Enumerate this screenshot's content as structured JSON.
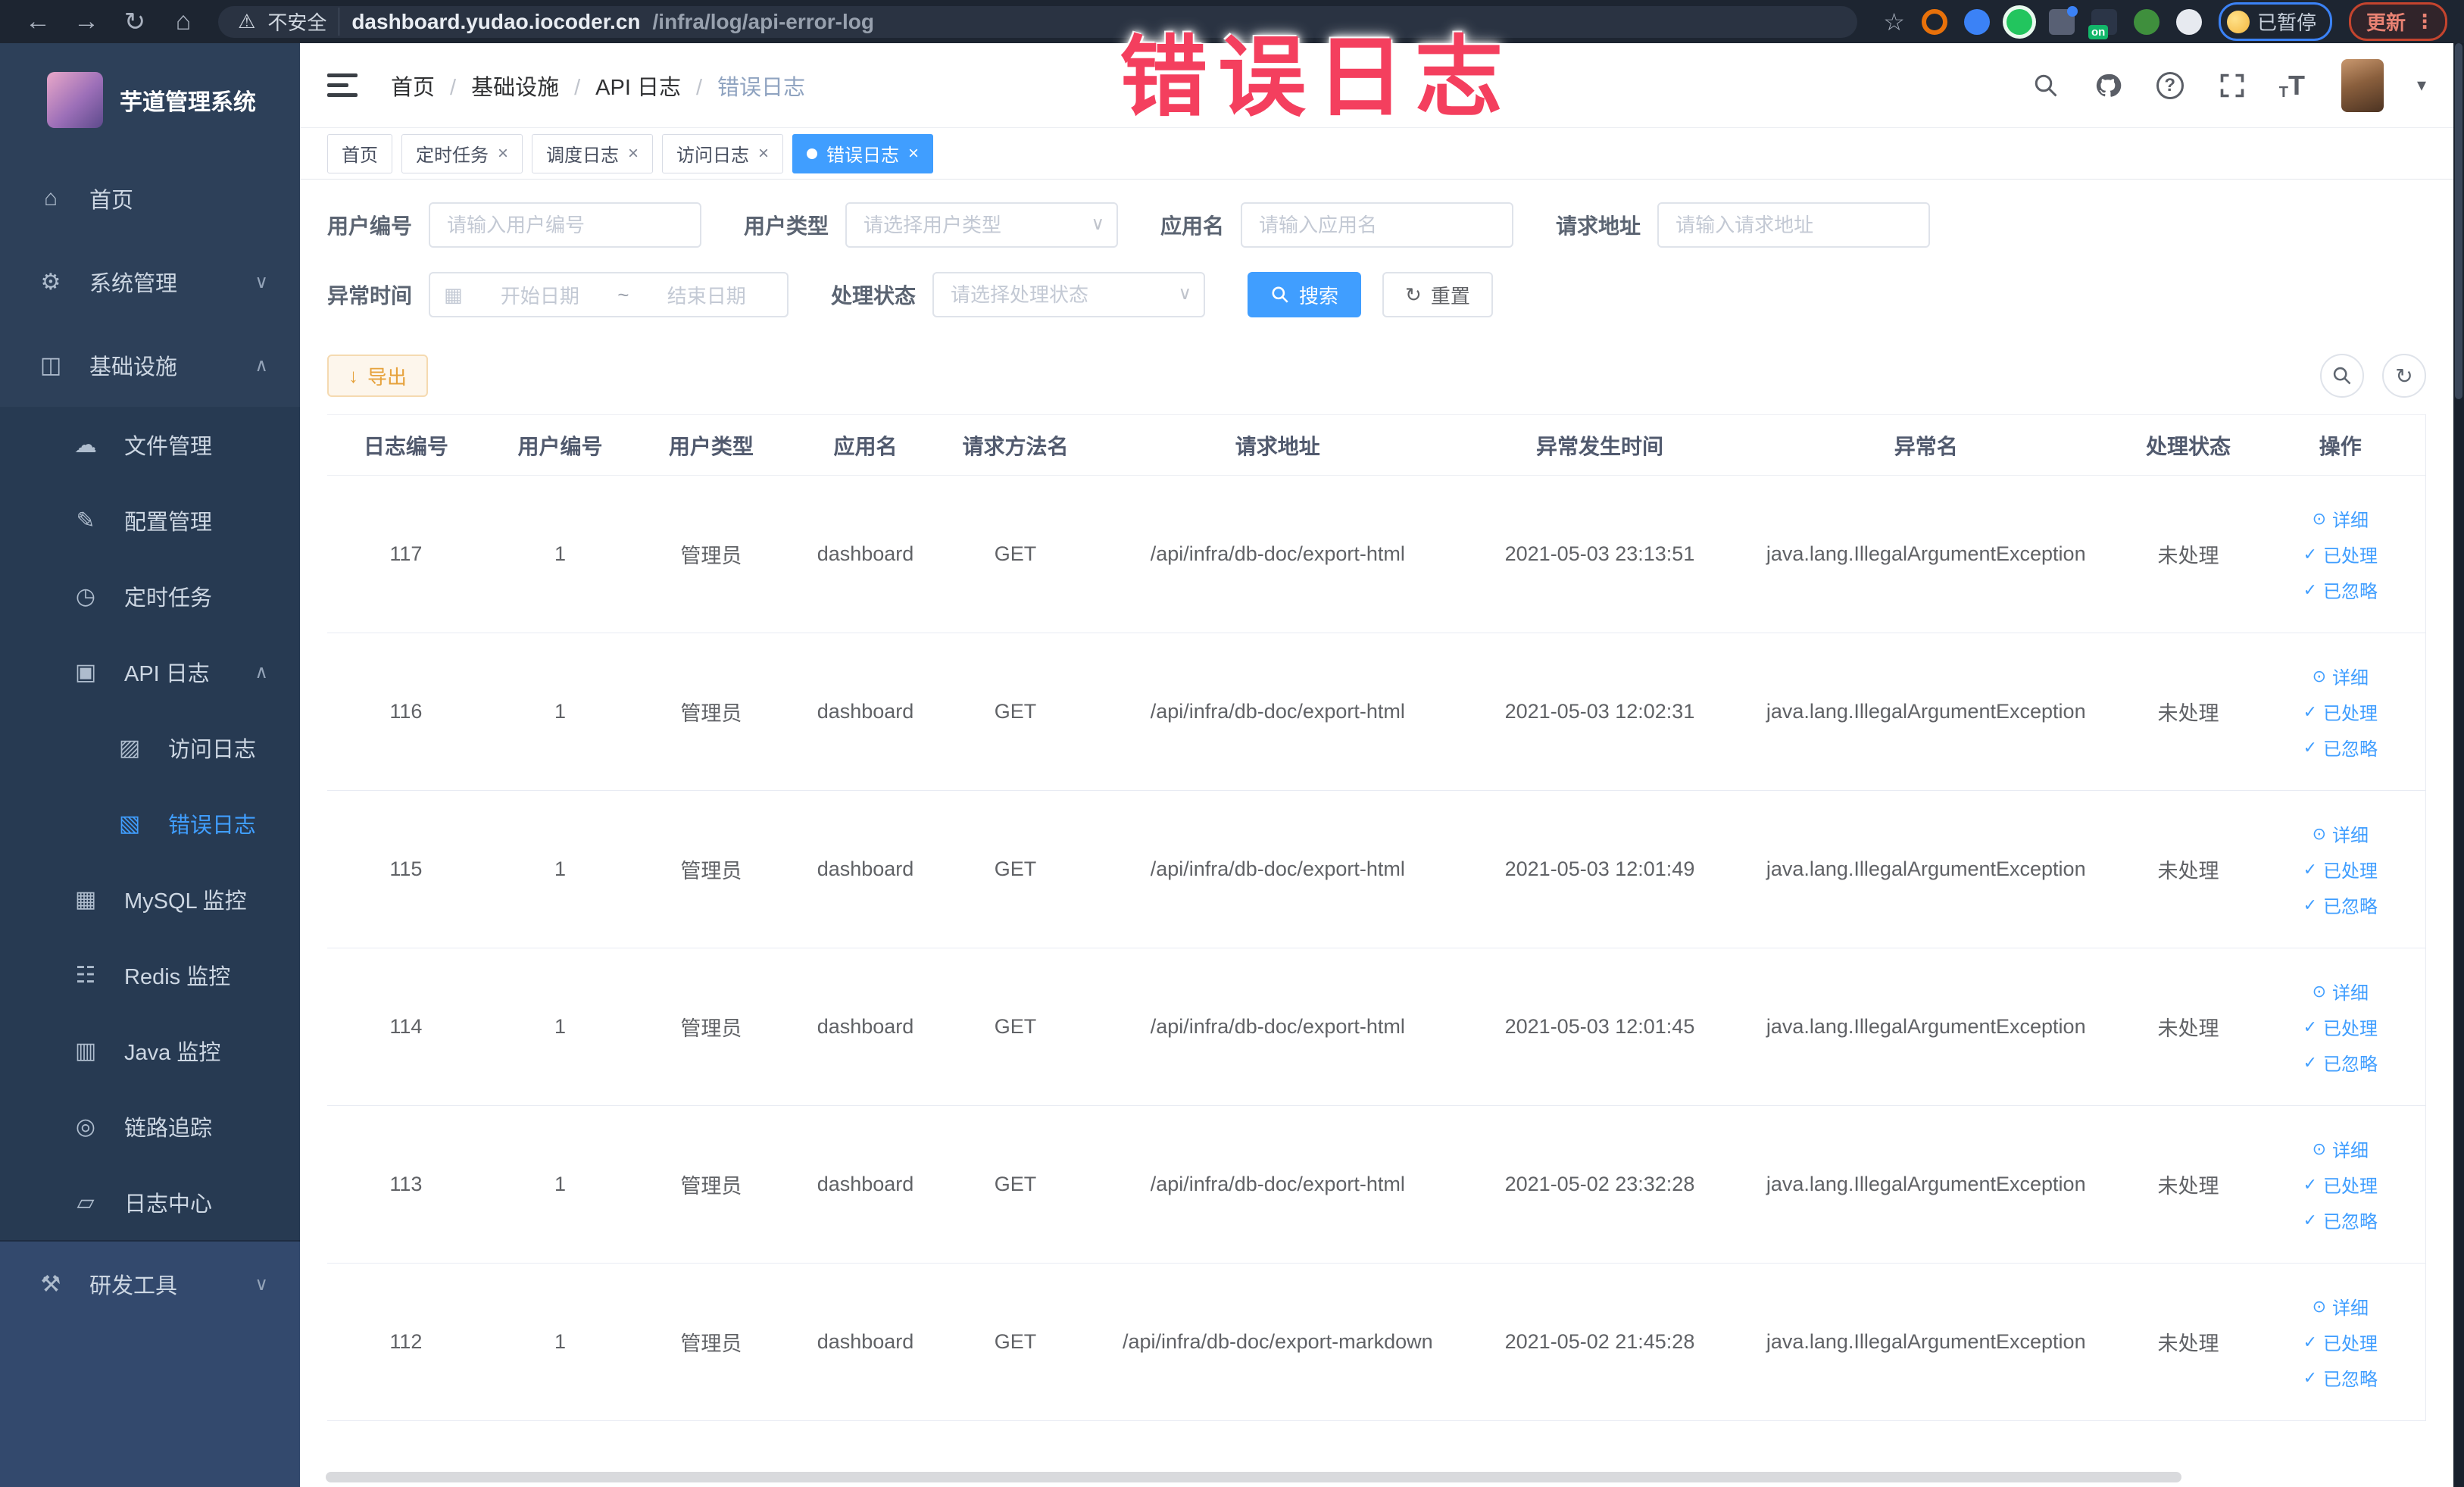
{
  "chrome": {
    "security_label": "不安全",
    "url_host": "dashboard.yudao.iocoder.cn",
    "url_path": "/infra/log/api-error-log",
    "paused_label": "已暂停",
    "update_label": "更新",
    "ext_badge": "on"
  },
  "overlay": {
    "title": "错误日志"
  },
  "icons": {
    "back": "←",
    "forward": "→",
    "reload": "↻",
    "home": "⌂",
    "warning": "⚠",
    "star": "☆",
    "dots": "⋮",
    "chevron_down": "∨",
    "chevron_up": "∧",
    "caret_down": "▾",
    "close": "×",
    "calendar": "▦",
    "tilde": "~",
    "download": "↓",
    "refresh": "↻",
    "eye": "⊙",
    "check": "✓",
    "question": "?",
    "font_size_big": "T",
    "font_size_small": "T"
  },
  "sidebar": {
    "title": "芋道管理系统",
    "items": [
      {
        "icon": "⌂",
        "label": "首页"
      },
      {
        "icon": "⚙",
        "label": "系统管理",
        "chevron": "∨"
      },
      {
        "icon": "◫",
        "label": "基础设施",
        "chevron": "∧"
      },
      {
        "icon": "☁",
        "label": "文件管理"
      },
      {
        "icon": "✎",
        "label": "配置管理"
      },
      {
        "icon": "◷",
        "label": "定时任务"
      },
      {
        "icon": "▣",
        "label": "API 日志",
        "chevron": "∧"
      },
      {
        "icon": "▨",
        "label": "访问日志"
      },
      {
        "icon": "▧",
        "label": "错误日志"
      },
      {
        "icon": "▦",
        "label": "MySQL 监控"
      },
      {
        "icon": "☷",
        "label": "Redis 监控"
      },
      {
        "icon": "▥",
        "label": "Java 监控"
      },
      {
        "icon": "◎",
        "label": "链路追踪"
      },
      {
        "icon": "▱",
        "label": "日志中心"
      },
      {
        "icon": "⚒",
        "label": "研发工具",
        "chevron": "∨"
      }
    ]
  },
  "navbar": {
    "breadcrumb": [
      "首页",
      "基础设施",
      "API 日志",
      "错误日志"
    ]
  },
  "tabs": [
    {
      "label": "首页"
    },
    {
      "label": "定时任务"
    },
    {
      "label": "调度日志"
    },
    {
      "label": "访问日志"
    },
    {
      "label": "错误日志"
    }
  ],
  "filters": {
    "user_id_label": "用户编号",
    "user_id_placeholder": "请输入用户编号",
    "user_type_label": "用户类型",
    "user_type_placeholder": "请选择用户类型",
    "app_name_label": "应用名",
    "app_name_placeholder": "请输入应用名",
    "request_url_label": "请求地址",
    "request_url_placeholder": "请输入请求地址",
    "exception_time_label": "异常时间",
    "date_start_placeholder": "开始日期",
    "date_end_placeholder": "结束日期",
    "process_status_label": "处理状态",
    "process_status_placeholder": "请选择处理状态",
    "search_label": "搜索",
    "reset_label": "重置"
  },
  "toolbar": {
    "export_label": "导出"
  },
  "table": {
    "columns": [
      "日志编号",
      "用户编号",
      "用户类型",
      "应用名",
      "请求方法名",
      "请求地址",
      "异常发生时间",
      "异常名",
      "处理状态",
      "操作"
    ],
    "actions": {
      "detail": "详细",
      "processed": "已处理",
      "ignored": "已忽略"
    },
    "rows": [
      {
        "id": "117",
        "user_id": "1",
        "user_type": "管理员",
        "app": "dashboard",
        "method": "GET",
        "url": "/api/infra/db-doc/export-html",
        "time": "2021-05-03 23:13:51",
        "exception": "java.lang.IllegalArgumentException",
        "status": "未处理"
      },
      {
        "id": "116",
        "user_id": "1",
        "user_type": "管理员",
        "app": "dashboard",
        "method": "GET",
        "url": "/api/infra/db-doc/export-html",
        "time": "2021-05-03 12:02:31",
        "exception": "java.lang.IllegalArgumentException",
        "status": "未处理"
      },
      {
        "id": "115",
        "user_id": "1",
        "user_type": "管理员",
        "app": "dashboard",
        "method": "GET",
        "url": "/api/infra/db-doc/export-html",
        "time": "2021-05-03 12:01:49",
        "exception": "java.lang.IllegalArgumentException",
        "status": "未处理"
      },
      {
        "id": "114",
        "user_id": "1",
        "user_type": "管理员",
        "app": "dashboard",
        "method": "GET",
        "url": "/api/infra/db-doc/export-html",
        "time": "2021-05-03 12:01:45",
        "exception": "java.lang.IllegalArgumentException",
        "status": "未处理"
      },
      {
        "id": "113",
        "user_id": "1",
        "user_type": "管理员",
        "app": "dashboard",
        "method": "GET",
        "url": "/api/infra/db-doc/export-html",
        "time": "2021-05-02 23:32:28",
        "exception": "java.lang.IllegalArgumentException",
        "status": "未处理"
      },
      {
        "id": "112",
        "user_id": "1",
        "user_type": "管理员",
        "app": "dashboard",
        "method": "GET",
        "url": "/api/infra/db-doc/export-markdown",
        "time": "2021-05-02 21:45:28",
        "exception": "java.lang.IllegalArgumentException",
        "status": "未处理"
      }
    ]
  }
}
